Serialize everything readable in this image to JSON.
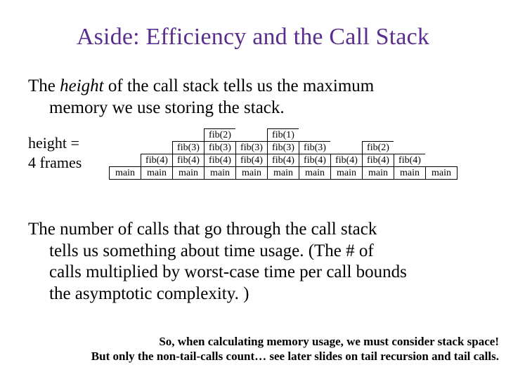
{
  "title": "Aside: Efficiency and the Call Stack",
  "para1_prefix": "The ",
  "para1_italic": "height",
  "para1_rest_l1": " of the call stack tells us the maximum",
  "para1_l2": "memory we use storing the stack.",
  "height_label_l1": "height =",
  "height_label_l2": "4 frames",
  "para2_l1": "The number of calls that go through the call stack",
  "para2_l2": "tells us something about time usage.  (The # of",
  "para2_l3": "calls multiplied by worst-case time per call bounds",
  "para2_l4": "the asymptotic complexity. )",
  "foot_l1": "So, when calculating memory usage, we must consider stack space!",
  "foot_l2": "But only the non-tail-calls count… see later slides on tail recursion and tail calls.",
  "stacks": [
    [
      "main"
    ],
    [
      "main",
      "fib(4)"
    ],
    [
      "main",
      "fib(4)",
      "fib(3)"
    ],
    [
      "main",
      "fib(4)",
      "fib(3)",
      "fib(2)"
    ],
    [
      "main",
      "fib(4)",
      "fib(3)"
    ],
    [
      "main",
      "fib(4)",
      "fib(3)",
      "fib(1)"
    ],
    [
      "main",
      "fib(4)",
      "fib(3)"
    ],
    [
      "main",
      "fib(4)"
    ],
    [
      "main",
      "fib(4)",
      "fib(2)"
    ],
    [
      "main",
      "fib(4)"
    ],
    [
      "main"
    ]
  ]
}
